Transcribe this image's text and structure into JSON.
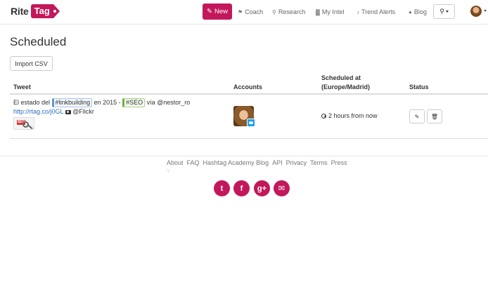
{
  "brand": {
    "part1": "Rite",
    "part2": "Tag",
    "accent": "#c2185b"
  },
  "nav": {
    "new_label": "New",
    "items": [
      {
        "label": "Coach",
        "icon": "graduation-cap-icon",
        "glyph": "⚑"
      },
      {
        "label": "Research",
        "icon": "search-icon",
        "glyph": "⚲"
      },
      {
        "label": "My Intel",
        "icon": "bar-chart-icon",
        "glyph": "▓"
      },
      {
        "label": "Trend Alerts",
        "icon": "bell-icon",
        "glyph": "♪"
      },
      {
        "label": "Blog",
        "icon": "comment-icon",
        "glyph": "●"
      }
    ],
    "search_glyph": "⚲"
  },
  "page": {
    "title": "Scheduled",
    "import_label": "Import CSV"
  },
  "table": {
    "headers": {
      "tweet": "Tweet",
      "accounts": "Accounts",
      "scheduled_line1": "Scheduled at",
      "scheduled_line2": "(Europe/Madrid)",
      "status": "Status"
    },
    "rows": [
      {
        "text_1": "El estado del ",
        "hashtag_1": "#linkbuilding",
        "text_2": " en 2015 - ",
        "hashtag_2": "#SEO",
        "text_3": " vía @nestor_ro",
        "link": "http://rtag.co/j0GL",
        "text_4": " @Flickr",
        "thumb_label": "SEO",
        "scheduled": "2 hours from now"
      }
    ]
  },
  "footer": {
    "links": [
      "About",
      "FAQ",
      "Hashtag Academy Blog",
      "API",
      "Privacy",
      "Terms",
      "Press"
    ],
    "social": [
      {
        "name": "twitter",
        "glyph": "t"
      },
      {
        "name": "facebook",
        "glyph": "f"
      },
      {
        "name": "google-plus",
        "glyph": "g+"
      },
      {
        "name": "email",
        "glyph": "✉"
      }
    ]
  }
}
